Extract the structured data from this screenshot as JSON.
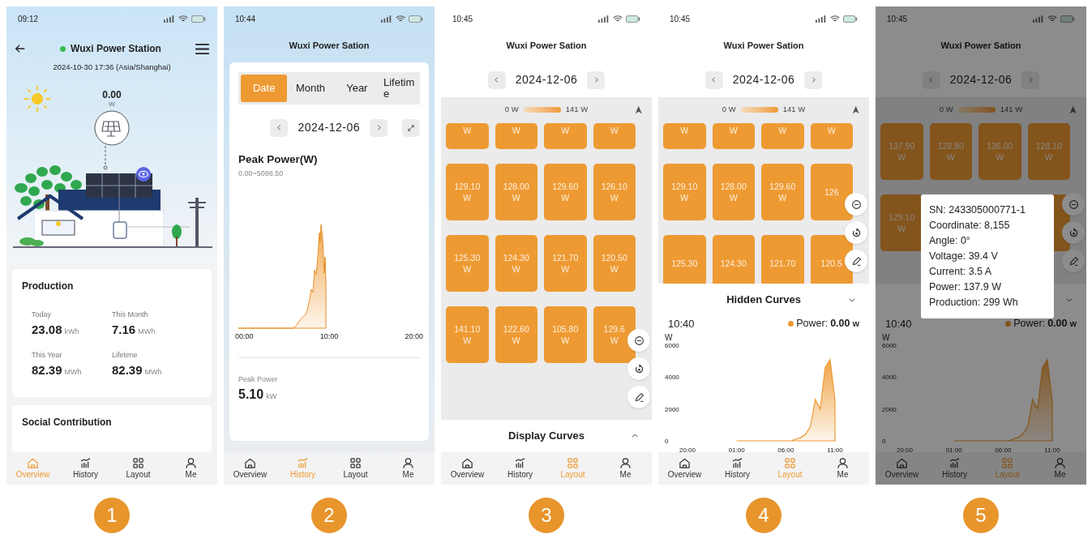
{
  "screens": [
    {
      "kind": "overview",
      "badge": "1",
      "status_time": "09:12",
      "title": "Wuxi Power Station",
      "online": true,
      "timestamp": "2024-10-30 17:36 (Asia/Shanghai)",
      "power": "0.00",
      "power_unit": "W",
      "production": {
        "title": "Production",
        "stats": [
          {
            "label": "Today",
            "value": "23.08",
            "unit": "kWh"
          },
          {
            "label": "This Month",
            "value": "7.16",
            "unit": "MWh"
          },
          {
            "label": "This Year",
            "value": "82.39",
            "unit": "MWh"
          },
          {
            "label": "Lifetime",
            "value": "82.39",
            "unit": "MWh"
          }
        ]
      },
      "next_section": "Social Contribution",
      "nav": [
        {
          "label": "Overview",
          "selected": true
        },
        {
          "label": "History",
          "selected": false
        },
        {
          "label": "Layout",
          "selected": false
        },
        {
          "label": "Me",
          "selected": false
        }
      ]
    },
    {
      "kind": "history",
      "badge": "2",
      "status_time": "10:44",
      "title": "Wuxi Power Sation",
      "tabs": [
        {
          "label": "Date",
          "selected": true
        },
        {
          "label": "Month",
          "selected": false
        },
        {
          "label": "Year",
          "selected": false
        },
        {
          "label": "Lifetime",
          "selected": false
        }
      ],
      "date": "2024-12-06",
      "chart_title": "Peak Power(W)",
      "chart_range": "0.00~5098.50",
      "x_labels": [
        "00:00",
        "10:00",
        "20:00"
      ],
      "summary": {
        "label": "Peak Power",
        "value": "5.10",
        "unit": "kW"
      },
      "nav": [
        {
          "label": "Overview",
          "selected": false
        },
        {
          "label": "History",
          "selected": true
        },
        {
          "label": "Layout",
          "selected": false
        },
        {
          "label": "Me",
          "selected": false
        }
      ]
    },
    {
      "kind": "layout",
      "badge": "3",
      "status_time": "10:45",
      "title": "Wuxi Power Sation",
      "date": "2024-12-06",
      "legend_min": "0 W",
      "legend_max": "141 W",
      "dimmed": false,
      "tile_rows": [
        [
          {
            "unit": "W"
          },
          {
            "unit": "W"
          },
          {
            "unit": "W"
          },
          {
            "unit": "W"
          }
        ],
        [
          {
            "value": "129.10",
            "unit": "W"
          },
          {
            "value": "128.00",
            "unit": "W"
          },
          {
            "value": "129.60",
            "unit": "W"
          },
          {
            "value": "126.10",
            "unit": "W"
          }
        ],
        [
          {
            "value": "125.30",
            "unit": "W"
          },
          {
            "value": "124.30",
            "unit": "W"
          },
          {
            "value": "121.70",
            "unit": "W"
          },
          {
            "value": "120.50",
            "unit": "W"
          }
        ],
        [
          {
            "value": "141.10",
            "unit": "W"
          },
          {
            "value": "122.60",
            "unit": "W"
          },
          {
            "value": "105.80",
            "unit": "W"
          },
          {
            "value": "129.6",
            "unit": "W"
          }
        ]
      ],
      "curves": {
        "label": "Display Curves",
        "expanded": false
      },
      "nav": [
        {
          "label": "Overview",
          "selected": false
        },
        {
          "label": "History",
          "selected": false
        },
        {
          "label": "Layout",
          "selected": true
        },
        {
          "label": "Me",
          "selected": false
        }
      ]
    },
    {
      "kind": "layout",
      "badge": "4",
      "status_time": "10:45",
      "title": "Wuxi Power Sation",
      "date": "2024-12-06",
      "legend_min": "0 W",
      "legend_max": "141 W",
      "dimmed": false,
      "tile_rows": [
        [
          {
            "unit": "W"
          },
          {
            "unit": "W"
          },
          {
            "unit": "W"
          },
          {
            "unit": "W"
          }
        ],
        [
          {
            "value": "129.10",
            "unit": "W"
          },
          {
            "value": "128.00",
            "unit": "W"
          },
          {
            "value": "129.60",
            "unit": "W"
          },
          {
            "value": "126"
          }
        ],
        [
          {
            "value": "125.30"
          },
          {
            "value": "124.30"
          },
          {
            "value": "121.70"
          },
          {
            "value": "120.5"
          }
        ]
      ],
      "curves": {
        "label": "Hidden Curves",
        "expanded": true,
        "time": "10:40",
        "legend": "Power:",
        "reading": "0.00",
        "reading_unit": "W",
        "chart_data": {
          "type": "area",
          "ylabel": "W",
          "categories": [
            "20:00",
            null,
            null,
            null,
            null,
            null,
            null,
            null,
            null,
            null,
            "01:00",
            null,
            null,
            null,
            null,
            null,
            null,
            null,
            null,
            null,
            "06:00",
            null,
            null,
            null,
            null,
            null,
            null,
            null,
            null,
            null,
            "11:00"
          ],
          "series": [
            {
              "color": "#ee9a33",
              "values": [
                null,
                null,
                null,
                null,
                null,
                null,
                null,
                null,
                null,
                null,
                0,
                0,
                0,
                0,
                0,
                0,
                0,
                0,
                0,
                0,
                0,
                0,
                100,
                200,
                400,
                900,
                2600,
                2000,
                4600,
                5100,
                2500
              ]
            }
          ],
          "ylim": [
            0,
            6000
          ],
          "yticks": [
            0,
            2000,
            4000,
            6000
          ]
        }
      },
      "nav": [
        {
          "label": "Overview",
          "selected": false
        },
        {
          "label": "History",
          "selected": false
        },
        {
          "label": "Layout",
          "selected": true
        },
        {
          "label": "Me",
          "selected": false
        }
      ]
    },
    {
      "kind": "layout",
      "badge": "5",
      "status_time": "10:45",
      "title": "Wuxi Power Sation",
      "date": "2024-12-06",
      "legend_min": "0 W",
      "legend_max": "141 W",
      "dimmed": true,
      "tile_rows": [
        [
          {
            "value": "137.90",
            "unit": "W"
          },
          {
            "value": "128.80",
            "unit": "W"
          },
          {
            "value": "136.00",
            "unit": "W"
          },
          {
            "value": "128.10",
            "unit": "W"
          }
        ],
        [
          {
            "value": "129.10",
            "unit": "W"
          }
        ]
      ],
      "curves": {
        "expanded": true,
        "time": "10:40",
        "legend": "Power:",
        "reading": "0.00",
        "reading_unit": "W",
        "chart_data": {
          "type": "area",
          "ylabel": "W",
          "categories": [
            "20:00",
            null,
            null,
            null,
            null,
            null,
            null,
            null,
            null,
            null,
            "01:00",
            null,
            null,
            null,
            null,
            null,
            null,
            null,
            null,
            null,
            "06:00",
            null,
            null,
            null,
            null,
            null,
            null,
            null,
            null,
            null,
            "11:00"
          ],
          "series": [
            {
              "color": "#ee9a33",
              "values": [
                null,
                null,
                null,
                null,
                null,
                null,
                null,
                null,
                null,
                null,
                0,
                0,
                0,
                0,
                0,
                0,
                0,
                0,
                0,
                0,
                0,
                0,
                100,
                200,
                400,
                900,
                2600,
                2000,
                4600,
                5100,
                2500
              ]
            }
          ],
          "ylim": [
            0,
            6000
          ],
          "yticks": [
            0,
            2000,
            4000,
            6000
          ]
        }
      },
      "popup": {
        "lines": [
          "SN: 243305000771-1",
          "Coordinate: 8,155",
          "Angle: 0°",
          "Voltage: 39.4 V",
          "Current: 3.5 A",
          "Power: 137.9 W",
          "Production: 299 Wh"
        ]
      },
      "nav": [
        {
          "label": "Overview",
          "selected": false
        },
        {
          "label": "History",
          "selected": false
        },
        {
          "label": "Layout",
          "selected": true
        },
        {
          "label": "Me",
          "selected": false
        }
      ]
    }
  ]
}
